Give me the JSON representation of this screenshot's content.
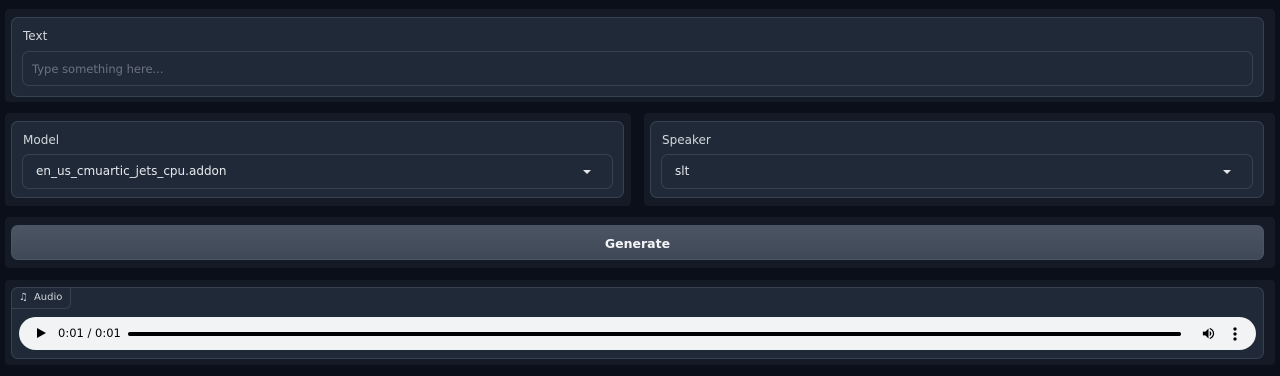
{
  "text_block": {
    "label": "Text",
    "placeholder": "Type something here...",
    "value": ""
  },
  "model": {
    "label": "Model",
    "selected": "en_us_cmuartic_jets_cpu.addon"
  },
  "speaker": {
    "label": "Speaker",
    "selected": "slt"
  },
  "generate_button": {
    "label": "Generate"
  },
  "audio": {
    "tag_label": "Audio",
    "tag_icon": "music-note-icon",
    "time": "0:01 / 0:01",
    "progress": 1.0,
    "icons": [
      "play-icon",
      "volume-icon",
      "more-options-icon"
    ]
  },
  "colors": {
    "background": "#0b0f19",
    "panel": "#1f2937",
    "border": "#374151",
    "button": "#4b5563",
    "player": "#f1f3f4"
  }
}
